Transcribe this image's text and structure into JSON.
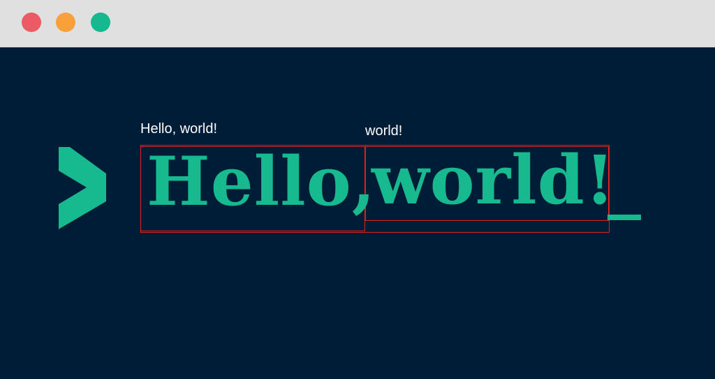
{
  "window": {
    "controls": {
      "close_color": "#ec5a66",
      "minimize_color": "#f9a03a",
      "maximize_color": "#15b88f"
    }
  },
  "colors": {
    "background": "#001d38",
    "accent": "#17b98f",
    "caption": "#ffffff",
    "bounding_box": "#e0201e"
  },
  "labels": {
    "full_phrase": "Hello, world!",
    "second_word": "world!"
  },
  "headline": {
    "part_one": "Hello,",
    "part_two": "world!"
  },
  "icons": {
    "prompt": "chevron-right-icon",
    "cursor": "underscore-cursor-icon"
  }
}
